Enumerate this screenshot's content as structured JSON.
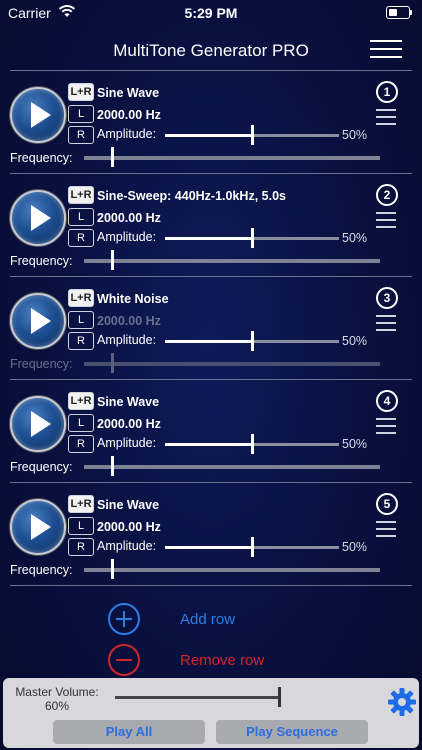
{
  "status_bar": {
    "carrier": "Carrier",
    "time": "5:29 PM"
  },
  "header": {
    "title": "MultiTone Generator PRO"
  },
  "rows": [
    {
      "number": "1",
      "channel_lr": "L+R",
      "channel_l": "L",
      "channel_r": "R",
      "waveform": "Sine Wave",
      "frequency": "2000.00 Hz",
      "amplitude_label": "Amplitude:",
      "amplitude": "50%",
      "amplitude_fraction": 0.5,
      "frequency_label": "Frequency:",
      "frequency_fraction": 0.09,
      "frequency_enabled": true
    },
    {
      "number": "2",
      "channel_lr": "L+R",
      "channel_l": "L",
      "channel_r": "R",
      "waveform": "Sine-Sweep: 440Hz-1.0kHz, 5.0s",
      "frequency": "2000.00 Hz",
      "amplitude_label": "Amplitude:",
      "amplitude": "50%",
      "amplitude_fraction": 0.5,
      "frequency_label": "Frequency:",
      "frequency_fraction": 0.09,
      "frequency_enabled": true
    },
    {
      "number": "3",
      "channel_lr": "L+R",
      "channel_l": "L",
      "channel_r": "R",
      "waveform": "White Noise",
      "frequency": "2000.00 Hz",
      "amplitude_label": "Amplitude:",
      "amplitude": "50%",
      "amplitude_fraction": 0.5,
      "frequency_label": "Frequency:",
      "frequency_fraction": 0.09,
      "frequency_enabled": false
    },
    {
      "number": "4",
      "channel_lr": "L+R",
      "channel_l": "L",
      "channel_r": "R",
      "waveform": "Sine Wave",
      "frequency": "2000.00 Hz",
      "amplitude_label": "Amplitude:",
      "amplitude": "50%",
      "amplitude_fraction": 0.5,
      "frequency_label": "Frequency:",
      "frequency_fraction": 0.09,
      "frequency_enabled": true
    },
    {
      "number": "5",
      "channel_lr": "L+R",
      "channel_l": "L",
      "channel_r": "R",
      "waveform": "Sine Wave",
      "frequency": "2000.00 Hz",
      "amplitude_label": "Amplitude:",
      "amplitude": "50%",
      "amplitude_fraction": 0.5,
      "frequency_label": "Frequency:",
      "frequency_fraction": 0.09,
      "frequency_enabled": true
    }
  ],
  "actions": {
    "add_row": "Add row",
    "remove_row": "Remove row"
  },
  "footer": {
    "master_volume_label": "Master Volume:",
    "master_volume": "60%",
    "master_volume_fraction": 1.0,
    "play_all": "Play All",
    "play_sequence": "Play Sequence"
  },
  "colors": {
    "accent_blue": "#2d7ee6",
    "remove_red": "#d0262a",
    "background": "#0a1244"
  },
  "icons": {
    "settings": "gear-icon",
    "menu": "hamburger-menu-icon",
    "play": "play-icon",
    "reorder": "drag-handle-icon"
  }
}
